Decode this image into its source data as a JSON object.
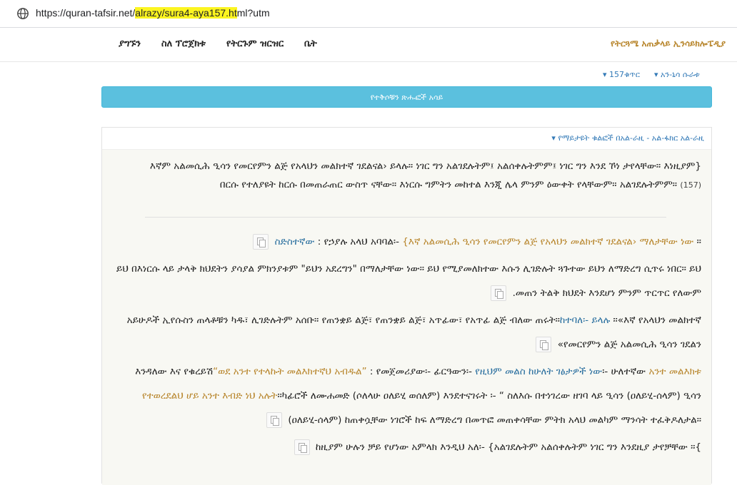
{
  "browser": {
    "url_prefix": "https://quran-tafsir.net/",
    "url_highlight_1": "alrazy/sura4-aya157.ht",
    "url_suffix": "ml?utm"
  },
  "navbar": {
    "brand": "የትርጓሜ አጠቃላይ ኢንሳይክሎፔዲያ",
    "items": [
      "ቤት",
      "የትርጉም ዝርዝር",
      "ስለ ፕሮጀክቱ",
      "ያግኙን"
    ]
  },
  "crumbs": {
    "sura": "አን-ኒሳ ሱራቱ",
    "aya": "157ቁጥር"
  },
  "button": {
    "label": "የተቅሶቹን ጽሑፎች አሳይ"
  },
  "panel": {
    "title": "የማይታዩት ቁልፎች በአል-ራዚ - አል-ፋክር አል-ራዚ",
    "ayah_text": "{እኛም አልመሲሕ ዒሳን የመርየምን ልጅ የአላህን መልክተኛ ገደልናል› ይላሉ። ነገር ግን አልገደሉትም፤ አልሰቀሉትምም፤ ነገር ግን እንደ ኾነ ታየላቸው። እነዚያም በርሱ የተለያዩት ከርሱ በመጠራጠር ውስጥ ናቸው። እነርሱ ግምትን መከተል እንጂ ሌላ ምንም ዕውቀት የላቸውም። አልገደሉትምም።",
    "ayah_num": "(157)"
  },
  "tafsir": {
    "p1_gold": "{እኛ አልመሲሕ ዒሳን የመርየምን ልጅ የአላህን መልክተኛ ገደልናል› ማለታቸው ነው",
    "p1_rest": " : የኃያሉ አላህ አባባል፡- ",
    "p1_blue": "ስድስተኛው",
    "p2": "ይህ በእነርሱ ላይ ታላቅ ክህደትን ያሳያል ምክንያቱም \"ይህን አደረግን\" በማለታቸው ነው። ይህ የሚያመለክተው እሱን ሊገድሉት ጓጉተው ይህን ለማድረግ ሲጥሩ ነበር። ይህ መጠን ትልቅ ክህደት እንደሆነ ምንም ጥርጥር የለውም.",
    "p3_text": "አይሁዶች ኢየሱስን ጠላቶቹን ካዱ፣ ሊገድሉትም አሰቡ። የጠንቋይ ልጅ፣ የጠንቋይ ልጅ፣ አጥፊው፣ የአጥፊ ልጅ ብለው ጠሩት።",
    "p3_blue": "ከተባለ፡- ይላሉ",
    "p3_end": " ።«እኛ የአላህን መልክተኛ የመርየምን ልጅ አልመሲሕ ዒሳን ገደልን»",
    "p4_start": "እንዳለው እና የቁረይሽ",
    "p4_gold": "“ወደ አንተ የተላኩት መልእክተኛህ አብዱል”",
    "p4_mid": " : የመጀመሪያው፡- ፊርዓውን፡- ",
    "p4_blue": "የዚህም መልስ ከሁለት ገፅታዎች ነው",
    "p5_start": "፡- ሁለተኛው ",
    "p5_gold": "አንተ መልእክቱ የተወረደልህ ሆይ አንተ እብድ ነህ አሉት",
    "p5_rest": "።ካፊሮች ለሙሐመድ (ሶለላሁ ዐለይሂ ወሰለም) እንደተናገሩት ፡- “ ስለእሱ በተነገረው ዘገባ ላይ ዒሳን (ዐለይሂ-ሰላም) ዒሳን (ዐለይሂ-ሰላም) ከጠቀሷቸው ነገሮች ከፍ ለማድረግ በመጥፎ መጠቀሳቸው ምትክ አላህ መልካም ማንሳት ተፈቅዶለታል።",
    "p6": "}ከዚያም ሁሉን ቻይ የሆነው አምላክ እንዲህ አለ፡- {አልገደሉትም አልሰቀሉትም ነገር ግን እንደዚያ ታየቻቸው ።"
  },
  "icons": [
    "globe-icon",
    "copy-icon"
  ]
}
